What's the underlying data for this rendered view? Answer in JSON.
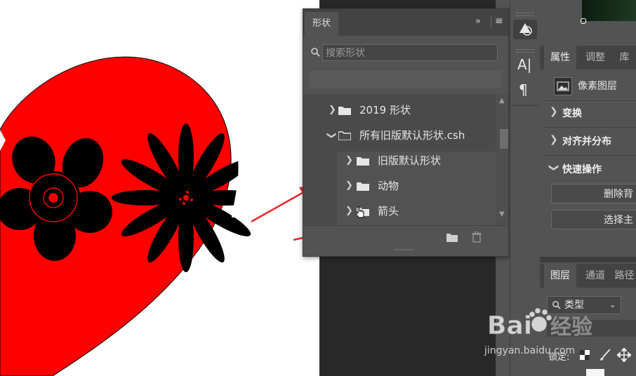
{
  "shapes_panel": {
    "tab": "形状",
    "collapse_icon": "double-chevron-right-icon",
    "menu_icon": "hamburger-menu-icon",
    "search_placeholder": "搜索形状",
    "items": [
      {
        "label": "2019 形状",
        "expanded": false,
        "level": 0
      },
      {
        "label": "所有旧版默认形状.csh",
        "expanded": true,
        "level": 0
      },
      {
        "label": "旧版默认形状",
        "expanded": false,
        "level": 1
      },
      {
        "label": "动物",
        "expanded": false,
        "level": 1
      },
      {
        "label": "箭头",
        "expanded": false,
        "level": 1
      }
    ],
    "footer_icons": [
      "new-folder-icon",
      "trash-icon"
    ]
  },
  "tools": {
    "text_tool": "A|",
    "paragraph_tool": "¶"
  },
  "properties_panel": {
    "tabs": [
      "属性",
      "调整",
      "库"
    ],
    "active_tab": "属性",
    "layer_kind": "像素图层",
    "sections": [
      "变换",
      "对齐并分布",
      "快速操作"
    ],
    "buttons": [
      "删除背",
      "选择主"
    ]
  },
  "layers_panel": {
    "tabs": [
      "图层",
      "通道",
      "路径"
    ],
    "active_tab": "图层",
    "filter_select": "类型",
    "lock_label": "锁定:"
  },
  "watermark": {
    "brand": "Baidu经验",
    "url": "jingyan.baidu.com"
  },
  "colors": {
    "heart_fill": "#ff0000",
    "flower_fill": "#000000",
    "annotation_arrow": "#e8262a",
    "panel_bg": "#535353"
  }
}
